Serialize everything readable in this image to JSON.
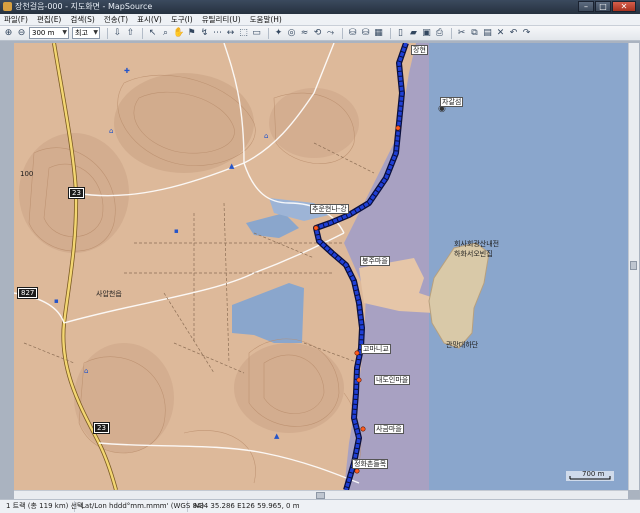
{
  "window": {
    "title": "장천걸음-000 - 지도화면 - MapSource",
    "minimize": "–",
    "maximize": "□",
    "close": "✕"
  },
  "menu": [
    "파일(F)",
    "편집(E)",
    "검색(S)",
    "전송(T)",
    "표시(V)",
    "도구(I)",
    "유틸리티(U)",
    "도움말(H)"
  ],
  "toolbar": {
    "zoom_combo": "300 m",
    "detail_combo": "최고"
  },
  "map": {
    "labels": {
      "island": "자갈섬",
      "poi_1": "추운현나-강",
      "poi_2": "봉주마을",
      "poi_3": "고마니교",
      "poi_4": "내도인마을",
      "poi_5": "사금마을",
      "poi_6": "정화촌들목",
      "poi_top": "장현",
      "island_east": "회사회광산내전",
      "island_east2": "하화서오빈집",
      "island_east3": "관망대하단",
      "road_23a": "23",
      "road_23b": "23",
      "road_827": "827",
      "town": "사압천읍",
      "contour_100": "100",
      "scale": "700 m"
    },
    "colors": {
      "land": "#ddb99a",
      "sea": "#8aa6cc",
      "sea_shallow": "#a8a1c2",
      "track": "#1f3fd6",
      "track_edge": "#0a0f3d"
    }
  },
  "status": {
    "track": "1 트랙 (총 119 km) 선택",
    "format": "Lat/Lon hddd°mm.mmm' (WGS 84)",
    "coords": "N34 35.286 E126 59.965, 0 m"
  }
}
